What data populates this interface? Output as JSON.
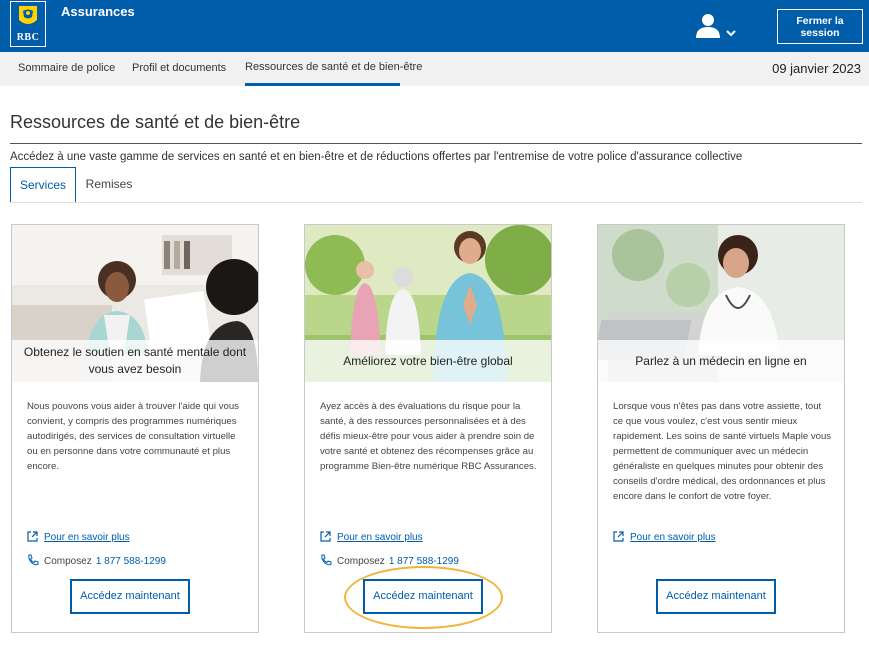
{
  "header": {
    "logo_text": "RBC",
    "brand": "Assurances",
    "logout_label": "Fermer la session"
  },
  "nav": {
    "tabs": [
      {
        "label": "Sommaire de police",
        "active": false
      },
      {
        "label": "Profil et documents",
        "active": false
      },
      {
        "label": "Ressources de santé et de bien-être",
        "active": true
      }
    ],
    "date": "09 janvier 2023"
  },
  "page": {
    "title": "Ressources de santé et de bien-être",
    "intro": "Accédez à une vaste gamme de services en santé et en bien-être et de réductions offertes par l'entremise de votre police d'assurance collective",
    "subtabs": [
      {
        "label": "Services",
        "active": true
      },
      {
        "label": "Remises",
        "active": false
      }
    ]
  },
  "cards": [
    {
      "title": "Obtenez le soutien en santé mentale dont vous avez besoin",
      "description": "Nous pouvons vous aider à trouver l'aide qui vous convient, y compris des programmes numériques autodirigés, des services de consultation virtuelle ou en personne dans votre communauté et plus encore.",
      "learn_more": "Pour en savoir plus",
      "phone_label": "Composez",
      "phone_number": "1 877 588-1299",
      "button": "Accédez maintenant"
    },
    {
      "title": "Améliorez votre bien-être global",
      "description": "Ayez accès à des évaluations du risque pour la santé, à des ressources personnalisées et à des défis mieux-être pour vous aider à prendre soin de votre santé et obtenez des récompenses grâce au programme Bien-être numérique RBC Assurances.",
      "learn_more": "Pour en savoir plus",
      "phone_label": "Composez",
      "phone_number": "1 877 588-1299",
      "button": "Accédez maintenant"
    },
    {
      "title": "Parlez à un médecin en ligne en",
      "description": "Lorsque vous n'êtes pas dans votre assiette, tout ce que vous voulez, c'est vous sentir mieux rapidement. Les soins de santé virtuels Maple vous permettent de communiquer avec un médecin généraliste en quelques minutes pour obtenir des conseils d'ordre médical, des ordonnances et plus encore dans le confort de votre foyer.",
      "learn_more": "Pour en savoir plus",
      "button": "Accédez maintenant"
    }
  ],
  "colors": {
    "brand_blue": "#005daa",
    "highlight": "#f0b63a",
    "nav_bg": "#f1f1f1"
  },
  "icons": [
    "rbc-lion-logo",
    "user-icon",
    "chevron-down-icon",
    "external-link-icon",
    "phone-icon"
  ]
}
